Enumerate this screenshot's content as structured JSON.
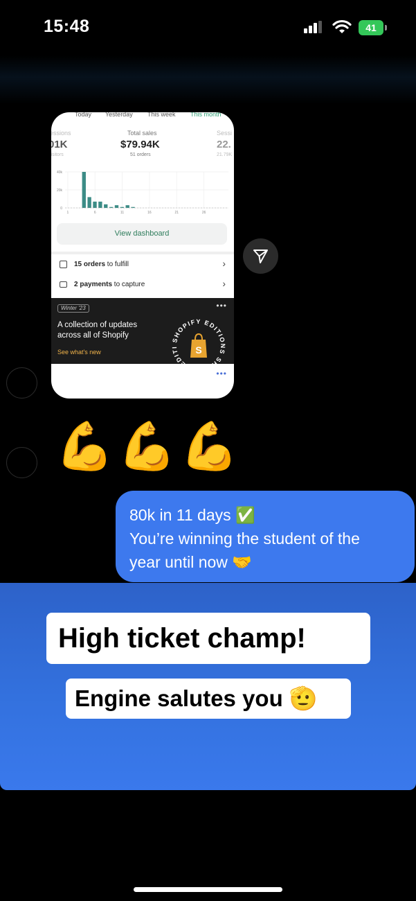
{
  "status_bar": {
    "time": "15:48",
    "battery": "41"
  },
  "shared_post": {
    "period_tabs": [
      "Today",
      "Yesterday",
      "This week",
      "This month"
    ],
    "metrics": [
      {
        "label": "Sessions",
        "value": "01K",
        "sub": "visitors"
      },
      {
        "label": "Total sales",
        "value": "$79.94K",
        "sub": "51 orders"
      },
      {
        "label": "Sessi",
        "value": "22.",
        "sub": "21.79K"
      }
    ],
    "chart_data": {
      "type": "bar",
      "y_ticks": [
        "40k",
        "20k",
        "0"
      ],
      "x_ticks": [
        "1",
        "6",
        "11",
        "16",
        "21",
        "26"
      ],
      "values": [
        0,
        0,
        0,
        40,
        12,
        7,
        7,
        4,
        1,
        3,
        1,
        3,
        1,
        0,
        0,
        0,
        0,
        0,
        0,
        0,
        0,
        0,
        0,
        0,
        0,
        0,
        0,
        0,
        0,
        0
      ],
      "ylim": [
        0,
        40
      ],
      "grid": true
    },
    "dashboard_button": "View dashboard",
    "tasks": [
      {
        "bold": "15 orders",
        "text": " to fulfill"
      },
      {
        "bold": "2 payments",
        "text": " to capture"
      }
    ],
    "promo": {
      "badge": "Winter '23",
      "title": "A collection of updates across all of Shopify",
      "link": "See what's new",
      "seal_text": "SHOPIFY EDITIONS"
    },
    "more_label": "•••"
  },
  "reactions": [
    "💪",
    "💪",
    "💪"
  ],
  "message": {
    "line1": "80k in 11 days ✅",
    "line2": "You’re winning the student of the",
    "line3": "year until now 🤝"
  },
  "reply_stickers": {
    "sticker1": "High ticket champ!",
    "sticker2": "Engine salutes you 🫡"
  },
  "colors": {
    "bubble": "#3d79ee",
    "panel": "#3371de",
    "chart_bar": "#3c8c86",
    "battery": "#34c759",
    "dashboard_link": "#2f7d5c",
    "promo_link": "#f0b34a"
  },
  "icons": [
    "cellular-signal-icon",
    "wifi-icon",
    "battery-icon",
    "share-send-icon",
    "fulfill-icon",
    "payment-icon",
    "chevron-right-icon",
    "more-icon"
  ]
}
